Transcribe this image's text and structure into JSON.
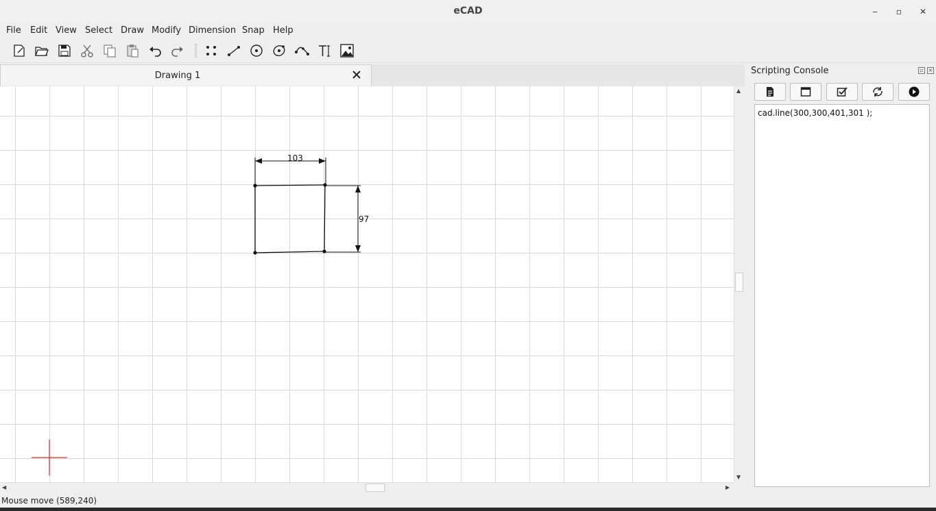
{
  "app": {
    "title": "eCAD"
  },
  "window_controls": {
    "minimize": "‒",
    "maximize": "▫",
    "close": "✕"
  },
  "menu": [
    "File",
    "Edit",
    "View",
    "Select",
    "Draw",
    "Modify",
    "Dimension",
    "Snap",
    "Help"
  ],
  "toolbar": {
    "file_tools": [
      "new-file-icon",
      "open-file-icon",
      "save-file-icon"
    ],
    "edit_tools": [
      "cut-icon",
      "copy-icon",
      "paste-icon",
      "undo-icon",
      "redo-icon"
    ],
    "draw_tools": [
      "point-icon",
      "line-icon",
      "circle-icon",
      "arc-icon",
      "spline-icon",
      "text-icon",
      "image-icon"
    ]
  },
  "tabs": [
    {
      "label": "Drawing 1",
      "active": true
    }
  ],
  "drawing": {
    "dimension_horizontal": "103",
    "dimension_vertical": "97"
  },
  "scripting_console": {
    "title": "Scripting Console",
    "buttons": [
      "new-script-icon",
      "window-icon",
      "check-icon",
      "refresh-icon",
      "run-icon"
    ],
    "code": "cad.line(300,300,401,301 );"
  },
  "status": {
    "message": "Mouse move (589,240)"
  },
  "colors": {
    "origin_marker": "#d9302a",
    "grid": "#d9d9d9",
    "canvas": "#ffffff"
  }
}
